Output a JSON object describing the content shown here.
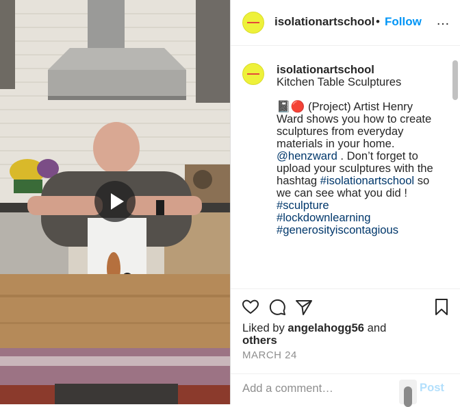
{
  "colors": {
    "accent": "#0095f6",
    "text": "#262626",
    "muted": "#8e8e8e",
    "link": "#00376b",
    "avatar_bg": "#eef13a",
    "avatar_line": "#e4483a"
  },
  "video": {
    "play_icon": "play-icon"
  },
  "header": {
    "username": "isolationartschool",
    "separator": "•",
    "follow_label": "Follow",
    "more_icon": "…"
  },
  "caption": {
    "username": "isolationartschool",
    "title": "Kitchen Table Sculptures",
    "emoji": "📓🔴",
    "text_1": " (Project) Artist Henry Ward shows you how to create sculptures from everyday materials in your home. ",
    "mention": "@henzward",
    "text_2": " . Don’t forget to upload your sculptures with the hashtag ",
    "hashtag_school": "#isolationartschool",
    "text_3": " so we can see what you did !",
    "hashtags": [
      "#sculpture",
      "#lockdownlearning",
      "#generosityiscontagious"
    ]
  },
  "actions": {
    "icons": [
      "heart-icon",
      "comment-icon",
      "share-icon",
      "bookmark-icon"
    ],
    "liked_by_prefix": "Liked by ",
    "liked_by_user": "angelahogg56",
    "liked_by_middle": " and",
    "liked_by_others": "others",
    "date": "MARCH 24"
  },
  "composer": {
    "placeholder": "Add a comment…",
    "post_label": "Post"
  }
}
